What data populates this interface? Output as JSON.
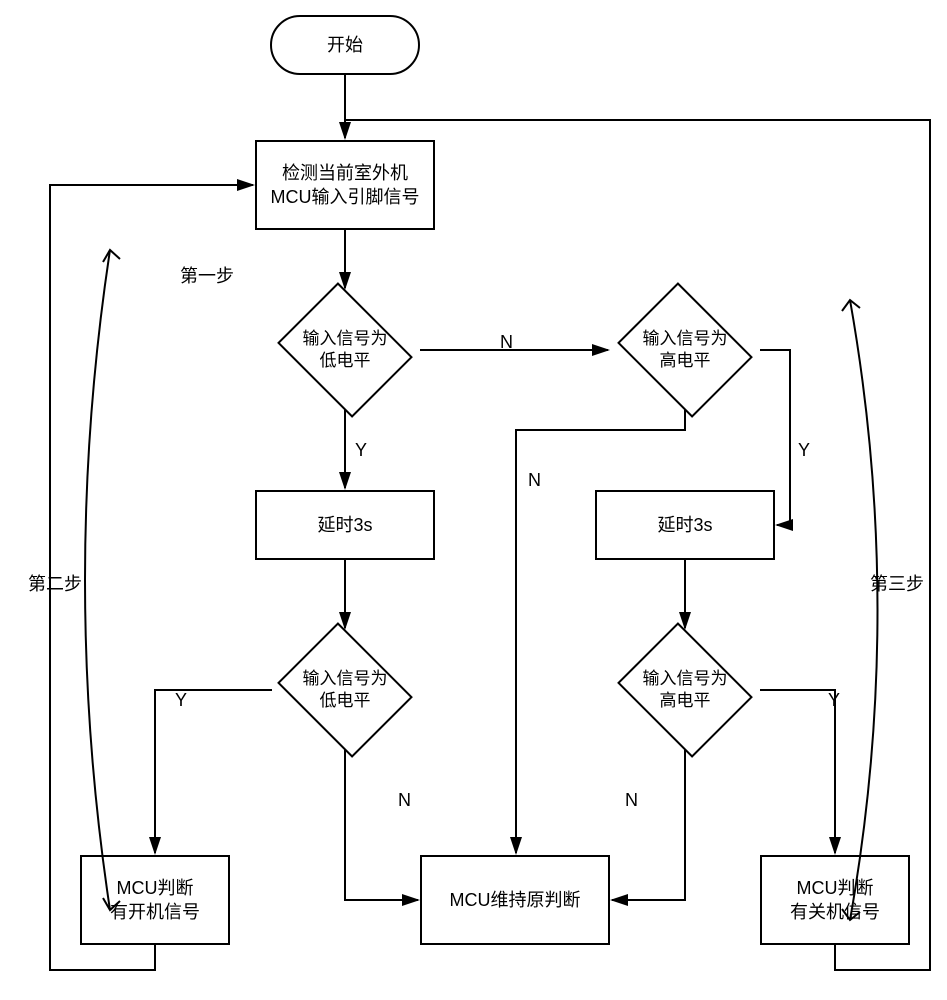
{
  "terminator": {
    "label": "开始"
  },
  "process_detect": {
    "label": "检测当前室外机\nMCU输入引脚信号"
  },
  "step_labels": {
    "step1": "第一步",
    "step2": "第二步",
    "step3": "第三步"
  },
  "decisions": {
    "d_low1": {
      "label": "输入信号为\n低电平"
    },
    "d_high1": {
      "label": "输入信号为\n高电平"
    },
    "d_low2": {
      "label": "输入信号为\n低电平"
    },
    "d_high2": {
      "label": "输入信号为\n高电平"
    }
  },
  "delays": {
    "left": "延时3s",
    "right": "延时3s"
  },
  "results": {
    "boot": "MCU判断\n有开机信号",
    "keep": "MCU维持原判断",
    "shutdown": "MCU判断\n有关机信号"
  },
  "edge_labels": {
    "yes": "Y",
    "no": "N"
  }
}
